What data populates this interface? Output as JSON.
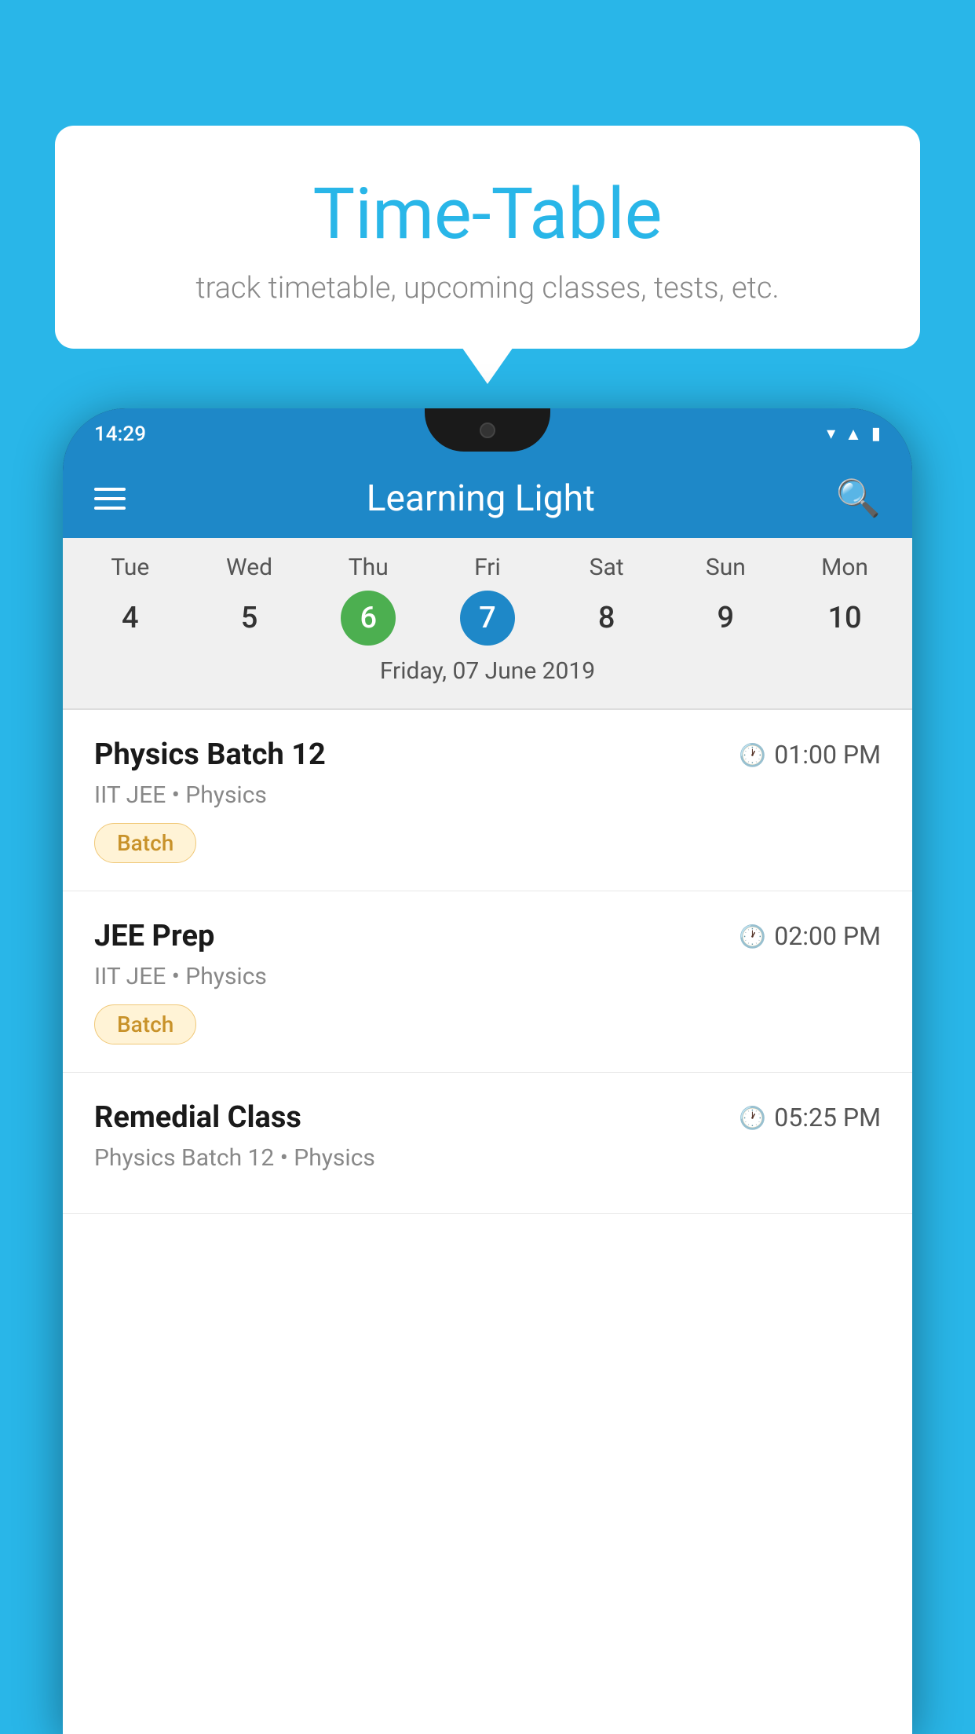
{
  "background_color": "#29B6E8",
  "speech_bubble": {
    "title": "Time-Table",
    "subtitle": "track timetable, upcoming classes, tests, etc."
  },
  "phone": {
    "status_bar": {
      "time": "14:29"
    },
    "app_header": {
      "title": "Learning Light"
    },
    "calendar": {
      "selected_date_label": "Friday, 07 June 2019",
      "days": [
        {
          "label": "Tue",
          "num": "4",
          "state": "normal"
        },
        {
          "label": "Wed",
          "num": "5",
          "state": "normal"
        },
        {
          "label": "Thu",
          "num": "6",
          "state": "today"
        },
        {
          "label": "Fri",
          "num": "7",
          "state": "selected"
        },
        {
          "label": "Sat",
          "num": "8",
          "state": "normal"
        },
        {
          "label": "Sun",
          "num": "9",
          "state": "normal"
        },
        {
          "label": "Mon",
          "num": "10",
          "state": "normal"
        }
      ]
    },
    "classes": [
      {
        "name": "Physics Batch 12",
        "time": "01:00 PM",
        "subtitle": "IIT JEE • Physics",
        "badge": "Batch"
      },
      {
        "name": "JEE Prep",
        "time": "02:00 PM",
        "subtitle": "IIT JEE • Physics",
        "badge": "Batch"
      },
      {
        "name": "Remedial Class",
        "time": "05:25 PM",
        "subtitle": "Physics Batch 12 • Physics",
        "badge": null
      }
    ]
  }
}
